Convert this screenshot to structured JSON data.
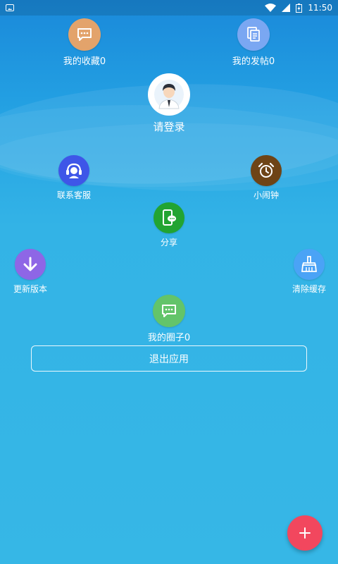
{
  "status_bar": {
    "time": "11:50",
    "icons": [
      "image-icon",
      "wifi-icon",
      "signal-icon",
      "battery-icon"
    ]
  },
  "top_items": {
    "favorites": {
      "label": "我的收藏0",
      "icon": "chat-icon",
      "color": "#e3a36b"
    },
    "posts": {
      "label": "我的发帖0",
      "icon": "document-icon",
      "color": "#7aa7f2"
    }
  },
  "profile": {
    "login_label": "请登录",
    "avatar_icon": "user-avatar-icon"
  },
  "menu": {
    "contact_service": {
      "label": "联系客服",
      "icon": "headset-icon",
      "color": "#3e56e8"
    },
    "alarm": {
      "label": "小闹钟",
      "icon": "alarm-clock-icon",
      "color": "#6e4416"
    },
    "share": {
      "label": "分享",
      "icon": "share-phone-icon",
      "color": "#22a432"
    },
    "update": {
      "label": "更新版本",
      "icon": "download-icon",
      "color": "#8e66e6"
    },
    "clear_cache": {
      "label": "清除缓存",
      "icon": "broom-icon",
      "color": "#4aa3f6"
    },
    "my_circle": {
      "label": "我的圈子0",
      "icon": "chat-icon",
      "color": "#63c46a"
    }
  },
  "logout_label": "退出应用",
  "fab": {
    "symbol": "+",
    "color": "#f2475e",
    "icon": "plus-icon"
  }
}
